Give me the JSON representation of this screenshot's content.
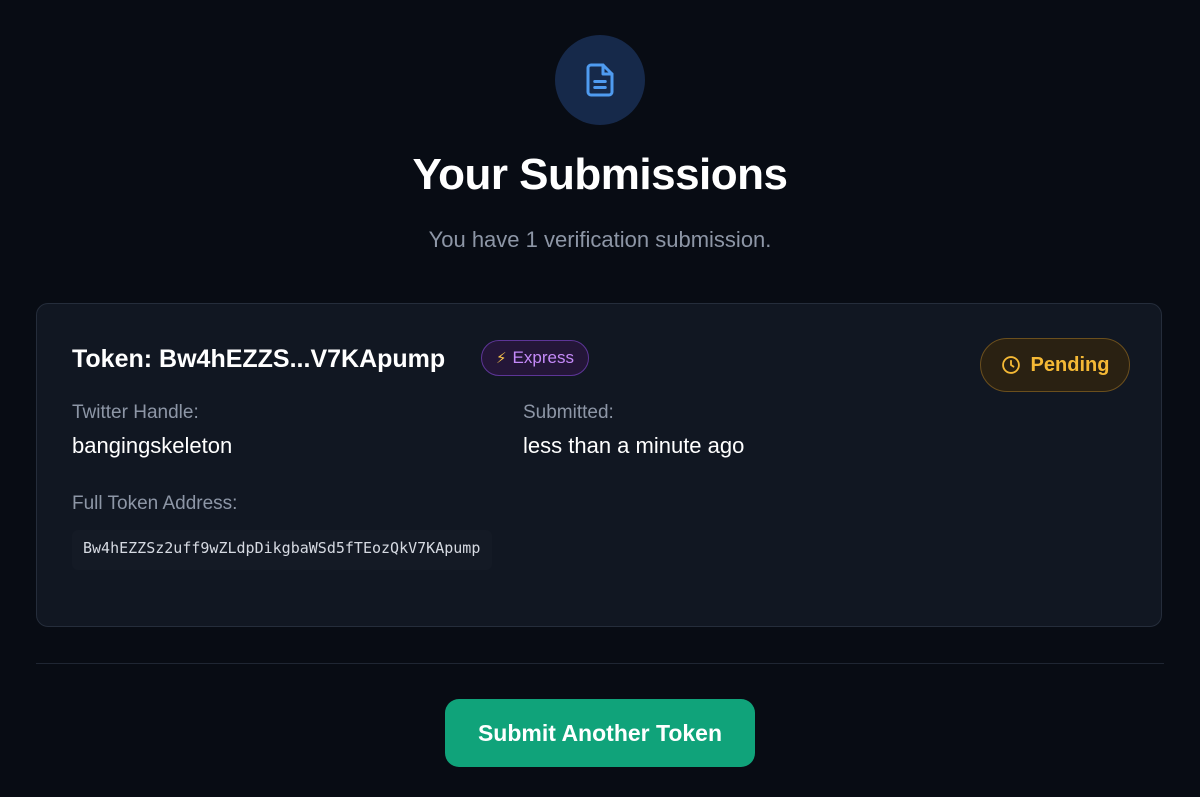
{
  "header": {
    "icon": "document-icon",
    "title": "Your Submissions",
    "subtitle": "You have 1 verification submission."
  },
  "submission": {
    "token_title": "Token: Bw4hEZZS...V7KApump",
    "badge_label": "Express",
    "badge_icon": "lightning-icon",
    "status_label": "Pending",
    "status_icon": "clock-icon",
    "twitter_label": "Twitter Handle:",
    "twitter_value": "bangingskeleton",
    "submitted_label": "Submitted:",
    "submitted_value": "less than a minute ago",
    "address_label": "Full Token Address:",
    "address_value": "Bw4hEZZSz2uff9wZLdpDikgbaWSd5fTEozQkV7KApump"
  },
  "actions": {
    "submit_label": "Submit Another Token"
  },
  "colors": {
    "background": "#080c14",
    "card": "#111722",
    "accent_green": "#10a37a",
    "pending": "#f5b935",
    "express": "#c58af9",
    "icon_blue": "#4f9bf0"
  }
}
